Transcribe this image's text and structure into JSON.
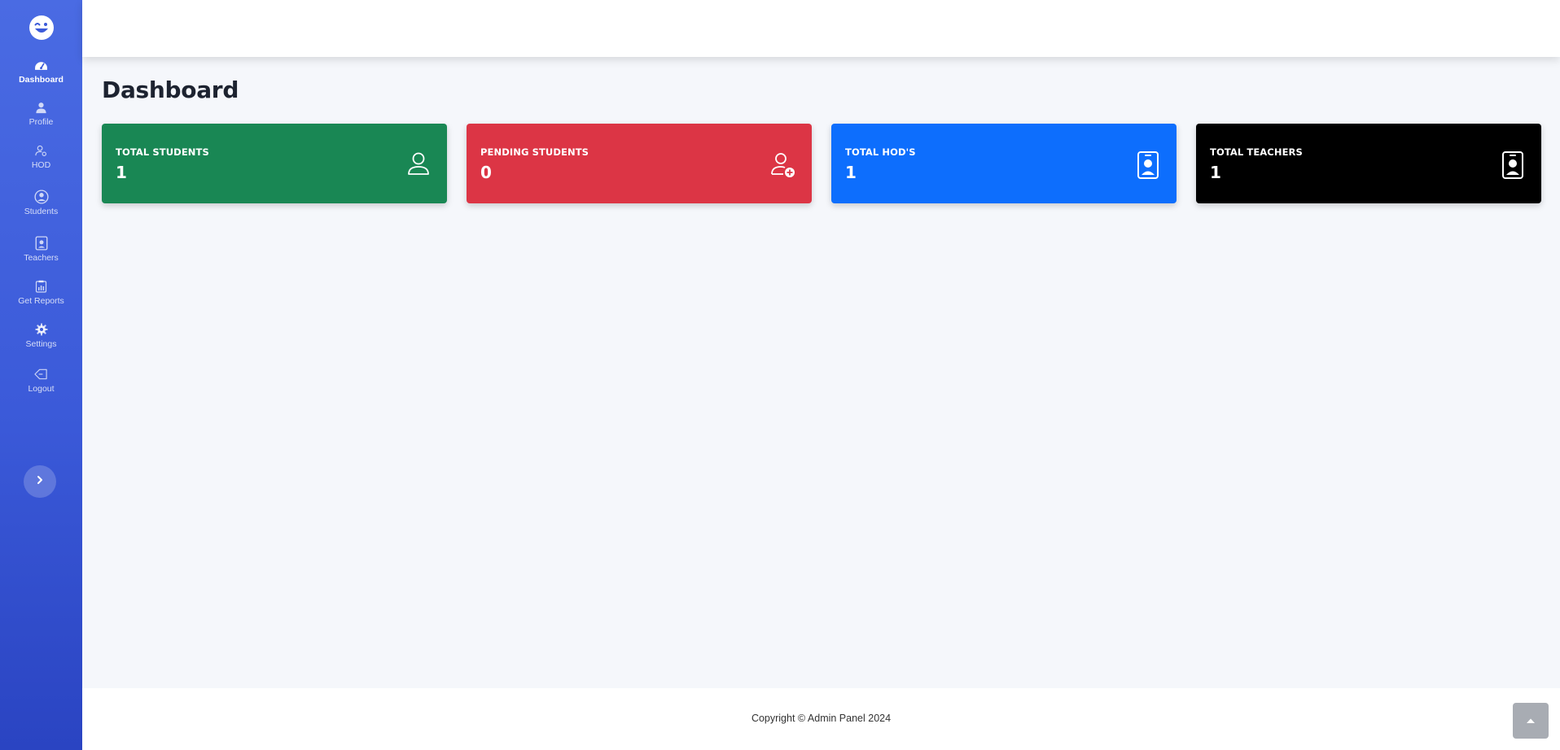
{
  "sidebar": {
    "logo_icon": "wink-smiley-icon",
    "items": [
      {
        "label": "Dashboard",
        "icon": "speedometer-icon",
        "active": true
      },
      {
        "label": "Profile",
        "icon": "person-icon",
        "active": false
      },
      {
        "label": "HOD",
        "icon": "person-gear-icon",
        "active": false
      },
      {
        "label": "Students",
        "icon": "person-circle-icon",
        "active": false
      },
      {
        "label": "Teachers",
        "icon": "person-badge-icon",
        "active": false
      },
      {
        "label": "Get Reports",
        "icon": "clipboard-data-icon",
        "active": false
      },
      {
        "label": "Settings",
        "icon": "gear-icon",
        "active": false
      },
      {
        "label": "Logout",
        "icon": "logout-icon",
        "active": false
      }
    ],
    "expand_icon": "chevron-right-icon"
  },
  "main": {
    "title": "Dashboard",
    "cards": [
      {
        "label": "TOTAL STUDENTS",
        "value": "1",
        "color": "#198754",
        "icon": "person-icon"
      },
      {
        "label": "PENDING STUDENTS",
        "value": "0",
        "color": "#dc3545",
        "icon": "person-add-icon"
      },
      {
        "label": "TOTAL HOD'S",
        "value": "1",
        "color": "#0d6efd",
        "icon": "person-badge-icon"
      },
      {
        "label": "TOTAL TEACHERS",
        "value": "1",
        "color": "#000000",
        "icon": "person-badge-icon"
      }
    ]
  },
  "footer": {
    "copyright": "Copyright © Admin Panel 2024",
    "scroll_top_icon": "caret-up-icon"
  },
  "colors": {
    "sidebar_top": "#4a6be3",
    "sidebar_bottom": "#2a44c2",
    "background": "#f5f7fb"
  }
}
